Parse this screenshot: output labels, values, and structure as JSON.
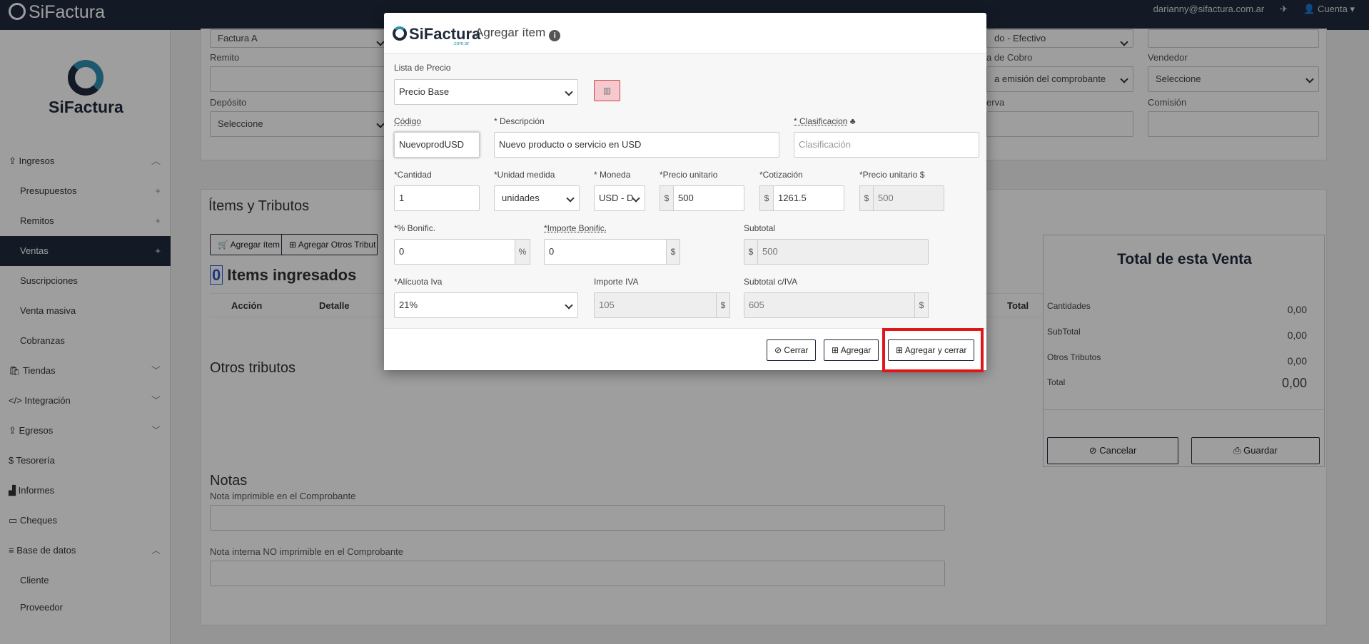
{
  "topbar": {
    "logo": "SiFactura",
    "user_email": "darianny@sifactura.com.ar",
    "account_label": "Cuenta"
  },
  "sidebar": {
    "logo_text": "SiFactura",
    "items": [
      {
        "label": "Ingresos",
        "icon": "upload-icon",
        "type": "section",
        "expanded": true
      },
      {
        "label": "Presupuestos",
        "type": "sub",
        "action": "+"
      },
      {
        "label": "Remitos",
        "type": "sub",
        "action": "+"
      },
      {
        "label": "Ventas",
        "type": "sub",
        "action": "+",
        "active": true
      },
      {
        "label": "Suscripciones",
        "type": "sub"
      },
      {
        "label": "Venta masiva",
        "type": "sub"
      },
      {
        "label": "Cobranzas",
        "type": "sub"
      },
      {
        "label": "Tiendas",
        "icon": "bag-icon",
        "type": "section"
      },
      {
        "label": "Integración",
        "icon": "code-icon",
        "type": "section"
      },
      {
        "label": "Egresos",
        "icon": "upload-icon",
        "type": "section"
      },
      {
        "label": "Tesorería",
        "icon": "dollar-icon",
        "type": "section"
      },
      {
        "label": "Informes",
        "icon": "chart-icon",
        "type": "section"
      },
      {
        "label": "Cheques",
        "icon": "card-icon",
        "type": "section"
      },
      {
        "label": "Base de datos",
        "icon": "database-icon",
        "type": "section",
        "expanded": true
      },
      {
        "label": "Cliente",
        "type": "sub"
      },
      {
        "label": "Proveedor",
        "type": "sub"
      }
    ]
  },
  "form_bg": {
    "comprobante_value": "Factura A",
    "remito_label": "Remito",
    "deposito_label": "Depósito",
    "deposito_value": "Seleccione",
    "condicion_value": "do - Efectivo",
    "fecha_cobro_label": "a de Cobro",
    "fecha_cobro_value": "a emisión del comprobante",
    "reserva_label": "erva",
    "vendedor_label": "Vendedor",
    "vendedor_value": "Seleccione",
    "comision_label": "Comisión"
  },
  "items_section": {
    "title": "Ítems y Tributos",
    "add_item": "Agregar ítem",
    "add_other": "Agregar Otros Tribut",
    "count": "0",
    "count_label": "Items ingresados",
    "col_accion": "Acción",
    "col_detalle": "Detalle",
    "col_total": "Total",
    "otros_title": "Otros tributos"
  },
  "notes": {
    "title": "Notas",
    "printable_label": "Nota imprimible en el Comprobante",
    "internal_label": "Nota interna NO imprimible en el Comprobante"
  },
  "totals": {
    "title": "Total de esta Venta",
    "rows": [
      {
        "label": "Cantidades",
        "value": "0,00"
      },
      {
        "label": "SubTotal",
        "value": "0,00"
      },
      {
        "label": "Otros Tributos",
        "value": "0,00"
      },
      {
        "label": "Total",
        "value": "0,00"
      }
    ],
    "cancel": "Cancelar",
    "save": "Guardar"
  },
  "modal": {
    "logo": "SiFactura",
    "logo_sub": ".com.ar",
    "title": "Agregar ítem",
    "lista_precio_label": "Lista de Precio",
    "lista_precio_value": "Precio Base",
    "codigo_label": "Código",
    "codigo_value": "NuevoprodUSD",
    "descripcion_label": "* Descripción",
    "descripcion_value": "Nuevo producto o servicio en USD",
    "clasificacion_label": "* Clasificacion",
    "clasificacion_placeholder": "Clasificación",
    "cantidad_label": "*Cantidad",
    "cantidad_value": "1",
    "unidad_label": "*Unidad medida",
    "unidad_value": "unidades",
    "moneda_label": "* Moneda",
    "moneda_value": "USD - D",
    "precio_unitario_label": "*Precio unitario",
    "precio_unitario_value": "500",
    "cotizacion_label": "*Cotización",
    "cotizacion_value": "1261.5",
    "precio_usd_label": "*Precio unitario $",
    "precio_usd_value": "500",
    "bonif_label": "*% Bonific.",
    "bonif_value": "0",
    "importe_bonif_label": "*Importe Bonific.",
    "importe_bonif_value": "0",
    "subtotal_label": "Subtotal",
    "subtotal_value": "500",
    "alicuota_label": "*Alícuota Iva",
    "alicuota_value": "21%",
    "importe_iva_label": "Importe IVA",
    "importe_iva_value": "105",
    "subtotal_iva_label": "Subtotal c/IVA",
    "subtotal_iva_value": "605",
    "dollar": "$",
    "percent": "%",
    "close": "Cerrar",
    "add": "Agregar",
    "add_close": "Agregar y cerrar"
  }
}
